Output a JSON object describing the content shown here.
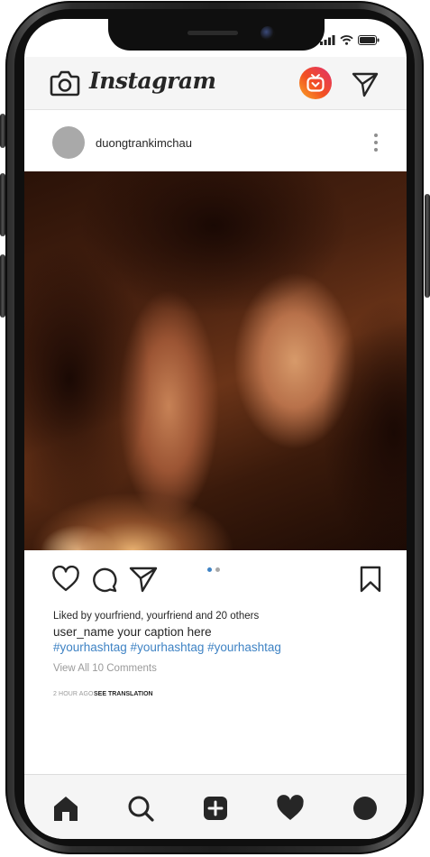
{
  "header": {
    "logo_text": "Instagram"
  },
  "post": {
    "username": "duongtrankimchau",
    "likes_text": "Liked by yourfriend, yourfriend and 20 others",
    "caption_text": "user_name  your caption here",
    "hashtags": "#yourhashtag #yourhashtag #yourhashtag",
    "view_comments": "View All 10 Comments",
    "timestamp": "2 HOUR AGO",
    "separator": "·",
    "see_translation": "SEE TRANSLATION",
    "carousel": {
      "count": 2,
      "active_index": 0
    }
  },
  "icons": {
    "camera": "camera-icon",
    "igtv": "igtv-icon",
    "direct": "send-icon",
    "more": "more-vertical-icon",
    "like": "heart-icon",
    "comment": "comment-icon",
    "share": "send-icon",
    "save": "bookmark-icon",
    "home": "home-icon",
    "search": "search-icon",
    "add": "add-post-icon",
    "activity": "heart-filled-icon",
    "profile": "profile-icon"
  },
  "colors": {
    "hashtag": "#3f83c4",
    "carousel_active": "#3f83c4",
    "carousel_inactive": "#a8a8a8",
    "text": "#262626",
    "muted": "#9a9a9a"
  }
}
